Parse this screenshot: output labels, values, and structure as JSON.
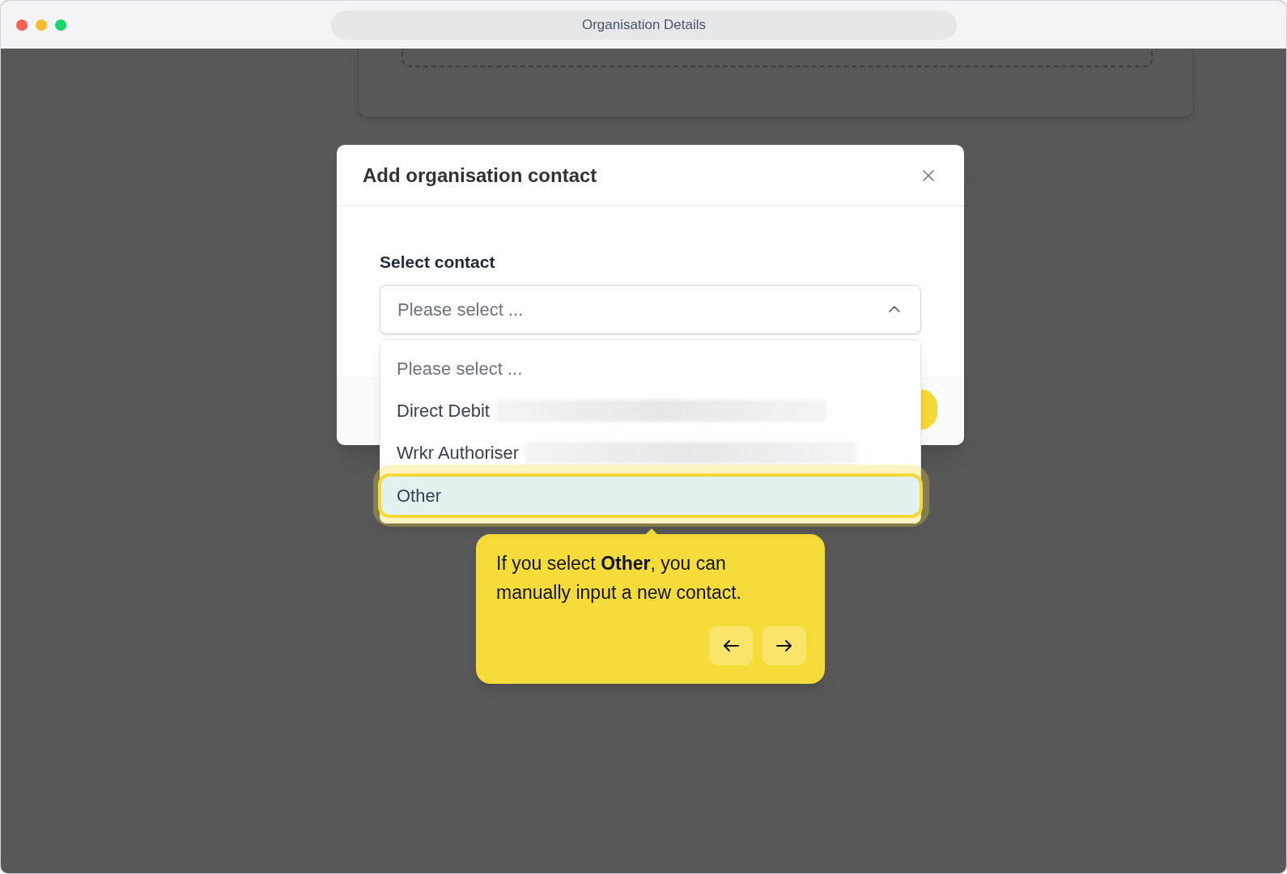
{
  "window": {
    "title": "Organisation Details"
  },
  "dialog": {
    "title": "Add organisation contact",
    "field": {
      "label": "Select contact",
      "placeholder": "Please select ...",
      "expanded": true
    },
    "options": [
      {
        "label": "Please select ...",
        "kind": "placeholder",
        "redacted": false,
        "highlighted": false
      },
      {
        "label": "Direct Debit",
        "kind": "option",
        "redacted": true,
        "highlighted": false
      },
      {
        "label": "Wrkr Authoriser",
        "kind": "option",
        "redacted": true,
        "highlighted": false
      },
      {
        "label": "Other",
        "kind": "option",
        "redacted": false,
        "highlighted": true
      }
    ]
  },
  "tour_tooltip": {
    "text": "If you select **Other**, you can manually input a new contact."
  }
}
